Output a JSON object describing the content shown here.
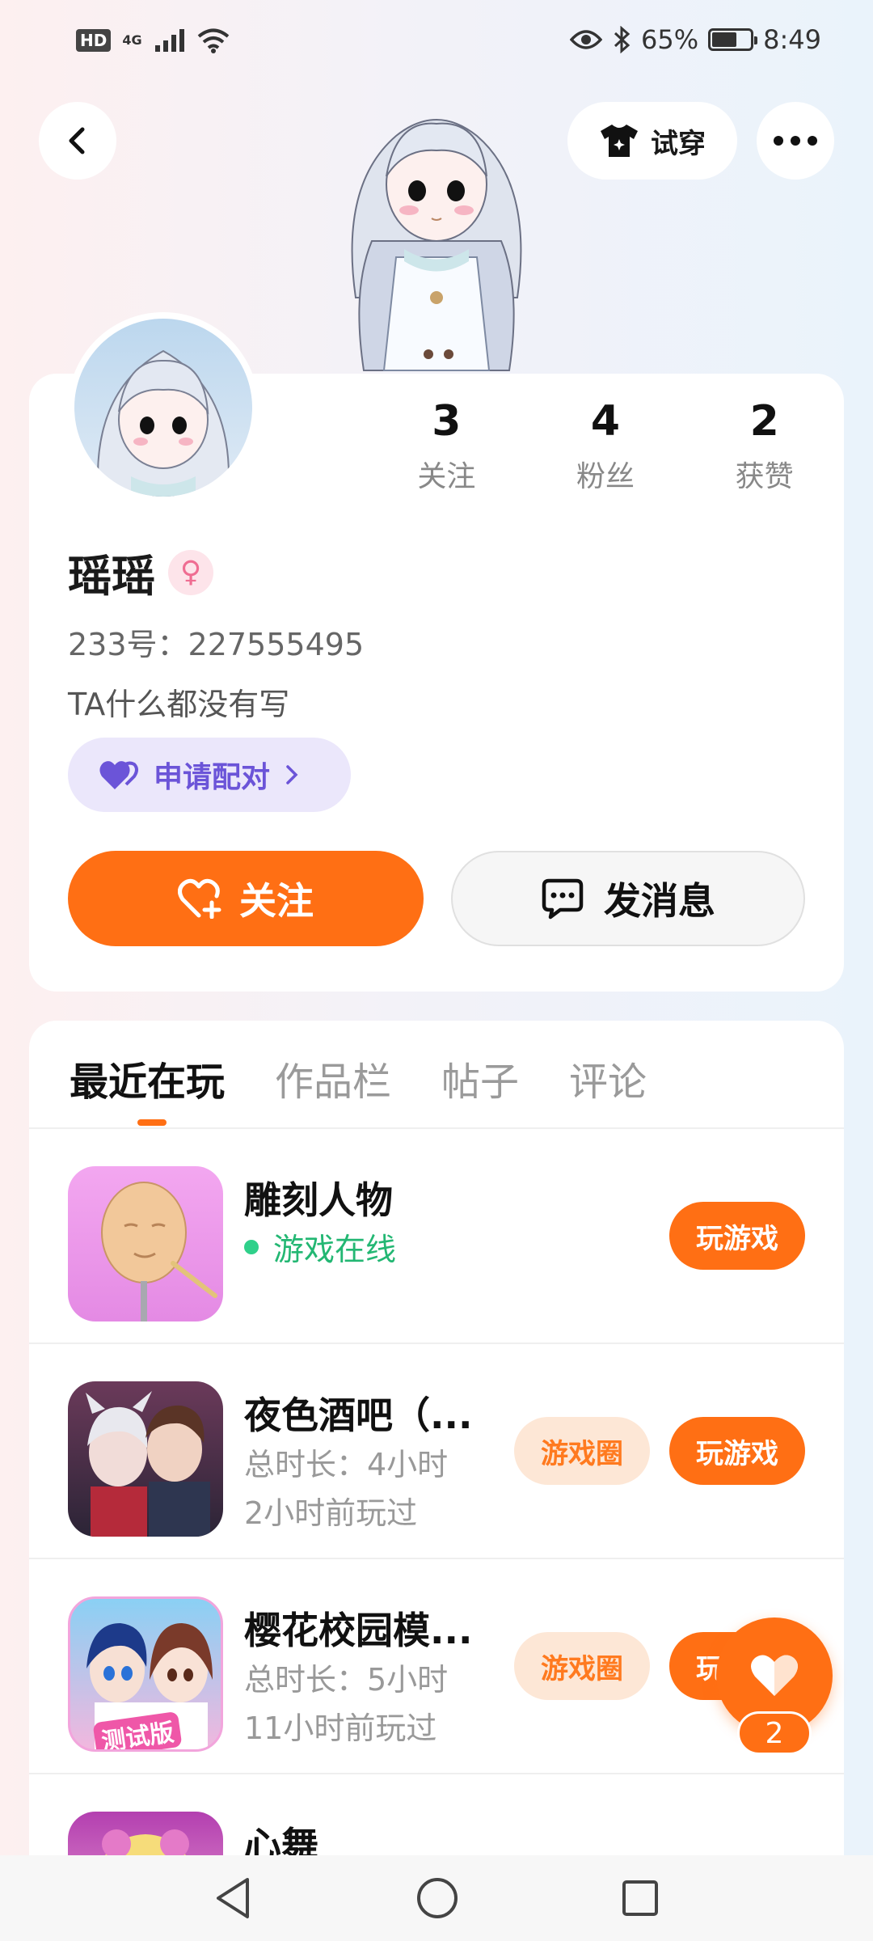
{
  "status_bar": {
    "hd": "HD",
    "network": "4G",
    "battery_percent": "65%",
    "battery_level": 0.65,
    "time": "8:49"
  },
  "header": {
    "try_on_label": "试穿"
  },
  "profile": {
    "stats": [
      {
        "value": "3",
        "label": "关注"
      },
      {
        "value": "4",
        "label": "粉丝"
      },
      {
        "value": "2",
        "label": "获赞"
      }
    ],
    "username": "瑶瑶",
    "gender_symbol": "♀",
    "uid": "233号：227555495",
    "bio": "TA什么都没有写",
    "pair_label": "申请配对",
    "follow_label": "关注",
    "message_label": "发消息"
  },
  "tabs": [
    {
      "label": "最近在玩",
      "active": true
    },
    {
      "label": "作品栏",
      "active": false
    },
    {
      "label": "帖子",
      "active": false
    },
    {
      "label": "评论",
      "active": false
    }
  ],
  "games": [
    {
      "name": "雕刻人物",
      "status": "游戏在线",
      "play_label": "玩游戏"
    },
    {
      "name": "夜色酒吧（...",
      "duration": "总时长：4小时",
      "last_played": "2小时前玩过",
      "circle_label": "游戏圈",
      "play_label": "玩游戏"
    },
    {
      "name": "樱花校园模...",
      "duration": "总时长：5小时",
      "last_played": "11小时前玩过",
      "circle_label": "游戏圈",
      "play_label": "玩游戏",
      "icon_badge": "测试版"
    },
    {
      "name": "心舞"
    }
  ],
  "float_like": {
    "count": "2"
  }
}
